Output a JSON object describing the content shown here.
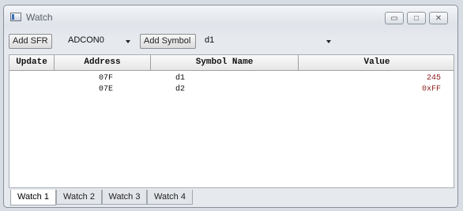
{
  "window": {
    "title": "Watch"
  },
  "window_controls": {
    "minimize": "▭",
    "maximize": "□",
    "close": "✕"
  },
  "toolbar": {
    "add_sfr_label": "Add SFR",
    "sfr_selected": "ADCON0",
    "add_symbol_label": "Add Symbol",
    "symbol_selected": "d1"
  },
  "table": {
    "headers": [
      "Update",
      "Address",
      "Symbol Name",
      "Value"
    ],
    "rows": [
      {
        "address": "07F",
        "symbol": "d1",
        "value": "245"
      },
      {
        "address": "07E",
        "symbol": "d2",
        "value": "0xFF"
      }
    ]
  },
  "tabs": [
    "Watch 1",
    "Watch 2",
    "Watch 3",
    "Watch 4"
  ],
  "active_tab": "Watch 1"
}
